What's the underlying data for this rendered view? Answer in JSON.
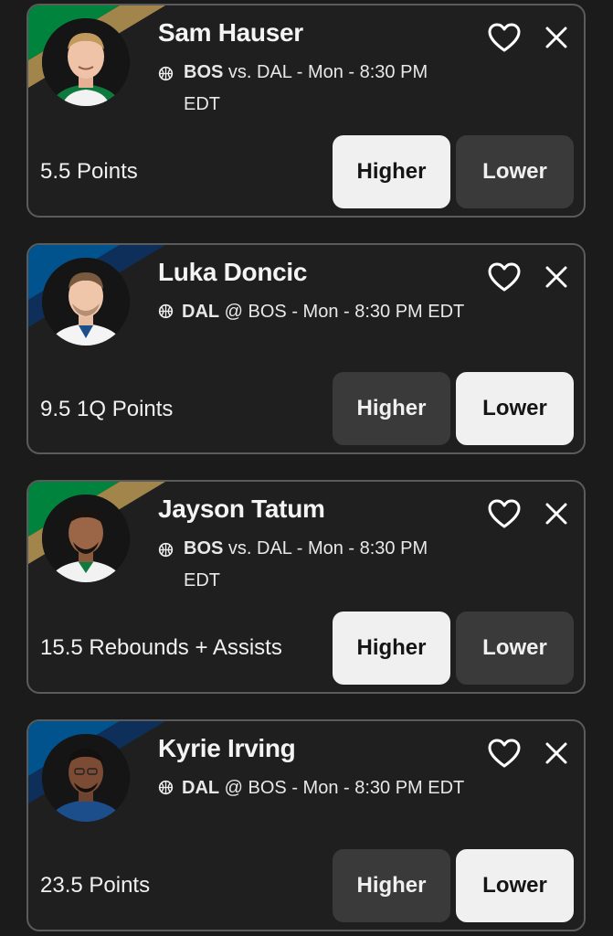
{
  "colors": {
    "background": "#1b1b1b",
    "card": "#1f1f1f",
    "card_border": "#5b5b5b",
    "selected_button": "#f0f0f0",
    "unselected_button": "#3a3a3a",
    "celtics_green": "#00843d",
    "celtics_gold": "#a1854a",
    "mavs_blue": "#00538c",
    "mavs_navy": "#0d2f5a"
  },
  "icons": {
    "favorite": "heart-outline-icon",
    "remove": "close-x-icon",
    "sport": "basketball-icon"
  },
  "cards": [
    {
      "player": "Sam Hauser",
      "team": "BOS",
      "matchup_rest": " vs. DAL - Mon - 8:30 PM EDT",
      "stat": "5.5 Points",
      "higher_label": "Higher",
      "lower_label": "Lower",
      "selected": "higher"
    },
    {
      "player": "Luka Doncic",
      "team": "DAL",
      "matchup_rest": " @ BOS - Mon - 8:30 PM EDT",
      "stat": "9.5 1Q Points",
      "higher_label": "Higher",
      "lower_label": "Lower",
      "selected": "lower"
    },
    {
      "player": "Jayson Tatum",
      "team": "BOS",
      "matchup_rest": " vs. DAL - Mon - 8:30 PM EDT",
      "stat": "15.5 Rebounds + Assists",
      "higher_label": "Higher",
      "lower_label": "Lower",
      "selected": "higher"
    },
    {
      "player": "Kyrie Irving",
      "team": "DAL",
      "matchup_rest": " @ BOS - Mon - 8:30 PM EDT",
      "stat": "23.5 Points",
      "higher_label": "Higher",
      "lower_label": "Lower",
      "selected": "lower"
    }
  ]
}
